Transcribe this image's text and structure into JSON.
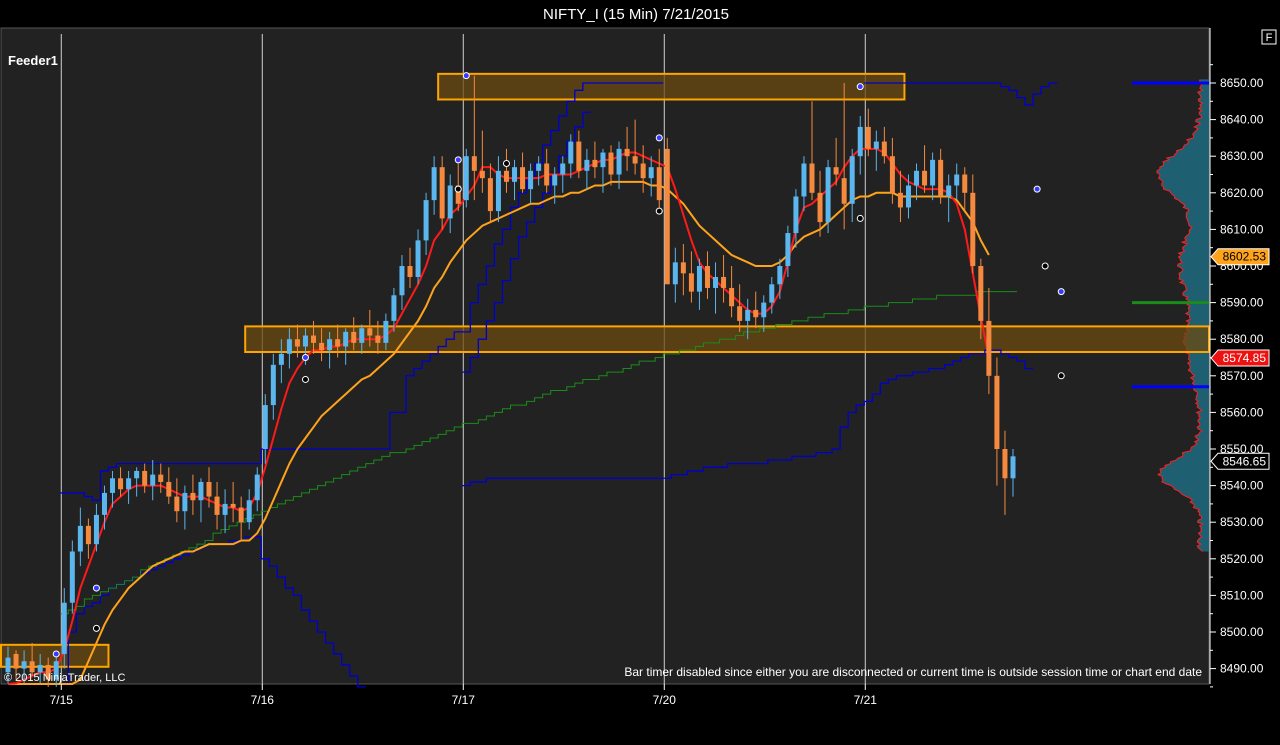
{
  "window": {
    "title": "NIFTY_I (15 Min)  7/21/2015",
    "f_button": "F"
  },
  "panel": {
    "label": "Feeder1",
    "copyright": "© 2015 NinjaTrader, LLC",
    "status_message": "Bar timer disabled since either you are disconnected or current time is outside session time or chart end date"
  },
  "colors": {
    "background": "#000000",
    "plot_bg": "#222222",
    "up_candle": "#5bb6ee",
    "down_candle": "#f58a3e",
    "fast_ma": "#ff1a1a",
    "slow_ma": "#ffa31a",
    "value_area_line": "#0000cc",
    "vwap_line": "#1a8c1a",
    "zone_fill": "#6b4a10",
    "zone_border": "#ffa500",
    "profile_fill": "#1e6a80",
    "profile_edge": "#ff2020",
    "level_blue": "#0000ff",
    "level_green": "#1a8c1a"
  },
  "chart_data": {
    "type": "candlestick",
    "title": "NIFTY_I (15 Min)  7/21/2015",
    "ylim": [
      8485,
      8658
    ],
    "y_ticks": [
      8490,
      8500,
      8510,
      8520,
      8530,
      8540,
      8550,
      8560,
      8570,
      8580,
      8590,
      8600,
      8610,
      8620,
      8630,
      8640,
      8650
    ],
    "y_tick_labels": [
      "8490.00",
      "8500.00",
      "8510.00",
      "8520.00",
      "8530.00",
      "8540.00",
      "8550.00",
      "8560.00",
      "8570.00",
      "8580.00",
      "8590.00",
      "8600.00",
      "8610.00",
      "8620.00",
      "8630.00",
      "8640.00",
      "8650.00"
    ],
    "x_labels": [
      "7/15",
      "7/16",
      "7/17",
      "7/20",
      "7/21"
    ],
    "session_start_bars": [
      7,
      32,
      57,
      82,
      107
    ],
    "price_markers": [
      {
        "value": 8602.53,
        "label": "8602.53",
        "color": "#ffa31a",
        "text_color": "#000000"
      },
      {
        "value": 8574.85,
        "label": "8574.85",
        "color": "#ee1111",
        "text_color": "#ffffff"
      },
      {
        "value": 8546.65,
        "label": "8546.65",
        "color": "#000000",
        "text_color": "#ffffff"
      }
    ],
    "zones": [
      {
        "from_bar": -5,
        "to_bar": 12,
        "low": 8490.5,
        "high": 8496.5
      },
      {
        "from_bar": 30,
        "to_bar": 160,
        "low": 8576.5,
        "high": 8583.5
      },
      {
        "from_bar": 54,
        "to_bar": 111,
        "low": 8645.5,
        "high": 8652.5
      }
    ],
    "profile_levels": [
      {
        "value": 8650,
        "color": "#0000ff"
      },
      {
        "value": 8590,
        "color": "#1a8c1a"
      },
      {
        "value": 8567,
        "color": "#0000ff"
      }
    ],
    "ohlc": [
      [
        8489,
        8496,
        8486,
        8493
      ],
      [
        8494,
        8495,
        8487,
        8490
      ],
      [
        8490,
        8495,
        8486,
        8492
      ],
      [
        8492,
        8497,
        8488,
        8489
      ],
      [
        8489,
        8494,
        8486,
        8491
      ],
      [
        8491,
        8493,
        8485,
        8487
      ],
      [
        8487,
        8494,
        8485,
        8492
      ],
      [
        8494,
        8512,
        8490,
        8508
      ],
      [
        8508,
        8525,
        8505,
        8522
      ],
      [
        8522,
        8534,
        8518,
        8529
      ],
      [
        8529,
        8531,
        8520,
        8524
      ],
      [
        8524,
        8535,
        8522,
        8532
      ],
      [
        8532,
        8540,
        8528,
        8538
      ],
      [
        8538,
        8544,
        8534,
        8542
      ],
      [
        8542,
        8545,
        8537,
        8539
      ],
      [
        8539,
        8544,
        8535,
        8542
      ],
      [
        8542,
        8545,
        8537,
        8544
      ],
      [
        8544,
        8546,
        8538,
        8540
      ],
      [
        8540,
        8547,
        8536,
        8543
      ],
      [
        8543,
        8546,
        8538,
        8541
      ],
      [
        8541,
        8545,
        8535,
        8537
      ],
      [
        8537,
        8542,
        8530,
        8533
      ],
      [
        8533,
        8540,
        8528,
        8538
      ],
      [
        8538,
        8543,
        8532,
        8536
      ],
      [
        8536,
        8542,
        8530,
        8541
      ],
      [
        8541,
        8545,
        8534,
        8537
      ],
      [
        8537,
        8541,
        8528,
        8532
      ],
      [
        8532,
        8539,
        8527,
        8535
      ],
      [
        8535,
        8541,
        8530,
        8534
      ],
      [
        8534,
        8537,
        8525,
        8530
      ],
      [
        8530,
        8539,
        8528,
        8536
      ],
      [
        8536,
        8545,
        8533,
        8543
      ],
      [
        8550,
        8565,
        8546,
        8562
      ],
      [
        8562,
        8576,
        8558,
        8573
      ],
      [
        8573,
        8580,
        8568,
        8576
      ],
      [
        8576,
        8583,
        8572,
        8580
      ],
      [
        8580,
        8584,
        8575,
        8578
      ],
      [
        8578,
        8583,
        8573,
        8581
      ],
      [
        8581,
        8585,
        8576,
        8579
      ],
      [
        8579,
        8583,
        8574,
        8577
      ],
      [
        8577,
        8582,
        8572,
        8580
      ],
      [
        8580,
        8584,
        8575,
        8578
      ],
      [
        8578,
        8583,
        8573,
        8582
      ],
      [
        8582,
        8586,
        8577,
        8579
      ],
      [
        8579,
        8584,
        8576,
        8583
      ],
      [
        8583,
        8588,
        8578,
        8581
      ],
      [
        8581,
        8585,
        8576,
        8579
      ],
      [
        8579,
        8587,
        8577,
        8585
      ],
      [
        8585,
        8594,
        8582,
        8592
      ],
      [
        8592,
        8603,
        8588,
        8600
      ],
      [
        8600,
        8605,
        8594,
        8597
      ],
      [
        8597,
        8610,
        8595,
        8607
      ],
      [
        8607,
        8620,
        8603,
        8618
      ],
      [
        8618,
        8630,
        8614,
        8627
      ],
      [
        8627,
        8630,
        8610,
        8613
      ],
      [
        8613,
        8625,
        8609,
        8622
      ],
      [
        8622,
        8628,
        8615,
        8617
      ],
      [
        8618,
        8632,
        8616,
        8630
      ],
      [
        8630,
        8652,
        8618,
        8626
      ],
      [
        8626,
        8637,
        8620,
        8624
      ],
      [
        8624,
        8628,
        8612,
        8615
      ],
      [
        8615,
        8630,
        8612,
        8626
      ],
      [
        8626,
        8632,
        8620,
        8623
      ],
      [
        8623,
        8629,
        8618,
        8627
      ],
      [
        8627,
        8631,
        8620,
        8621
      ],
      [
        8621,
        8628,
        8617,
        8626
      ],
      [
        8626,
        8630,
        8622,
        8628
      ],
      [
        8628,
        8632,
        8620,
        8622
      ],
      [
        8622,
        8627,
        8617,
        8625
      ],
      [
        8625,
        8630,
        8620,
        8628
      ],
      [
        8628,
        8636,
        8624,
        8634
      ],
      [
        8634,
        8637,
        8624,
        8626
      ],
      [
        8626,
        8632,
        8621,
        8629
      ],
      [
        8629,
        8634,
        8624,
        8627
      ],
      [
        8627,
        8632,
        8620,
        8631
      ],
      [
        8631,
        8633,
        8622,
        8625
      ],
      [
        8625,
        8634,
        8621,
        8632
      ],
      [
        8632,
        8638,
        8626,
        8630
      ],
      [
        8630,
        8640,
        8625,
        8628
      ],
      [
        8628,
        8633,
        8620,
        8624
      ],
      [
        8624,
        8630,
        8619,
        8627
      ],
      [
        8627,
        8632,
        8615,
        8618
      ],
      [
        8632,
        8635,
        8615,
        8595
      ],
      [
        8595,
        8605,
        8590,
        8601
      ],
      [
        8601,
        8606,
        8592,
        8598
      ],
      [
        8598,
        8604,
        8590,
        8593
      ],
      [
        8593,
        8602,
        8588,
        8600
      ],
      [
        8600,
        8604,
        8591,
        8594
      ],
      [
        8594,
        8601,
        8587,
        8597
      ],
      [
        8597,
        8603,
        8590,
        8594
      ],
      [
        8594,
        8600,
        8586,
        8589
      ],
      [
        8589,
        8595,
        8582,
        8585
      ],
      [
        8585,
        8591,
        8580,
        8588
      ],
      [
        8588,
        8593,
        8583,
        8586
      ],
      [
        8586,
        8592,
        8582,
        8590
      ],
      [
        8590,
        8597,
        8587,
        8595
      ],
      [
        8595,
        8602,
        8591,
        8600
      ],
      [
        8600,
        8611,
        8597,
        8609
      ],
      [
        8609,
        8621,
        8605,
        8619
      ],
      [
        8619,
        8630,
        8615,
        8628
      ],
      [
        8628,
        8645,
        8618,
        8620
      ],
      [
        8620,
        8626,
        8608,
        8612
      ],
      [
        8612,
        8629,
        8609,
        8627
      ],
      [
        8627,
        8635,
        8622,
        8625
      ],
      [
        8624,
        8650,
        8610,
        8617
      ],
      [
        8617,
        8632,
        8612,
        8630
      ],
      [
        8630,
        8641,
        8625,
        8638
      ],
      [
        8638,
        8643,
        8630,
        8632
      ],
      [
        8632,
        8637,
        8626,
        8634
      ],
      [
        8634,
        8638,
        8628,
        8630
      ],
      [
        8630,
        8635,
        8617,
        8620
      ],
      [
        8620,
        8626,
        8612,
        8616
      ],
      [
        8616,
        8625,
        8613,
        8622
      ],
      [
        8622,
        8628,
        8618,
        8626
      ],
      [
        8626,
        8633,
        8620,
        8622
      ],
      [
        8622,
        8631,
        8618,
        8629
      ],
      [
        8629,
        8632,
        8617,
        8619
      ],
      [
        8619,
        8625,
        8612,
        8622
      ],
      [
        8622,
        8628,
        8618,
        8625
      ],
      [
        8625,
        8627,
        8615,
        8620
      ],
      [
        8620,
        8625,
        8598,
        8600
      ],
      [
        8600,
        8602,
        8580,
        8585
      ],
      [
        8585,
        8594,
        8565,
        8570
      ],
      [
        8570,
        8575,
        8540,
        8550
      ],
      [
        8550,
        8555,
        8532,
        8542
      ],
      [
        8542,
        8550,
        8537,
        8548
      ]
    ],
    "fast_ma": [
      8485,
      8486,
      8487,
      8488,
      8489,
      8489,
      8490,
      8495,
      8503,
      8512,
      8518,
      8524,
      8530,
      8535,
      8537,
      8539,
      8540,
      8540,
      8540,
      8540,
      8539,
      8538,
      8537,
      8537,
      8537,
      8536,
      8535,
      8534,
      8534,
      8533,
      8534,
      8538,
      8545,
      8553,
      8561,
      8568,
      8572,
      8575,
      8577,
      8577,
      8578,
      8578,
      8579,
      8580,
      8580,
      8580,
      8580,
      8581,
      8583,
      8587,
      8591,
      8595,
      8600,
      8607,
      8610,
      8614,
      8616,
      8619,
      8622,
      8627,
      8627,
      8625,
      8624,
      8624,
      8624,
      8624,
      8624,
      8625,
      8625,
      8625,
      8625,
      8626,
      8627,
      8628,
      8629,
      8629,
      8630,
      8631,
      8631,
      8630,
      8629,
      8628,
      8627,
      8621,
      8614,
      8607,
      8601,
      8598,
      8596,
      8594,
      8592,
      8590,
      8588,
      8587,
      8587,
      8589,
      8593,
      8601,
      8610,
      8616,
      8617,
      8619,
      8621,
      8623,
      8627,
      8630,
      8632,
      8632,
      8632,
      8631,
      8628,
      8625,
      8623,
      8622,
      8621,
      8621,
      8621,
      8620,
      8617,
      8610,
      8598,
      8586,
      8575
    ],
    "slow_ma": [
      8470,
      8471,
      8472,
      8473,
      8474,
      8475,
      8476,
      8478,
      8482,
      8487,
      8492,
      8497,
      8502,
      8506,
      8509,
      8512,
      8514,
      8516,
      8518,
      8519,
      8520,
      8521,
      8522,
      8522,
      8523,
      8524,
      8524,
      8524,
      8524,
      8525,
      8525,
      8527,
      8531,
      8536,
      8541,
      8546,
      8550,
      8553,
      8556,
      8559,
      8561,
      8563,
      8565,
      8567,
      8569,
      8570,
      8572,
      8574,
      8576,
      8579,
      8582,
      8585,
      8589,
      8594,
      8597,
      8601,
      8604,
      8607,
      8609,
      8611,
      8612,
      8613,
      8614,
      8615,
      8616,
      8617,
      8617,
      8618,
      8619,
      8619,
      8620,
      8620,
      8621,
      8622,
      8622,
      8623,
      8623,
      8623,
      8623,
      8623,
      8622,
      8622,
      8621,
      8619,
      8617,
      8614,
      8611,
      8609,
      8607,
      8605,
      8603,
      8602,
      8601,
      8600,
      8600,
      8600,
      8601,
      8603,
      8606,
      8608,
      8609,
      8610,
      8612,
      8614,
      8616,
      8618,
      8619,
      8619,
      8620,
      8620,
      8620,
      8619,
      8619,
      8619,
      8619,
      8619,
      8619,
      8619,
      8618,
      8615,
      8612,
      8607,
      8603
    ]
  }
}
